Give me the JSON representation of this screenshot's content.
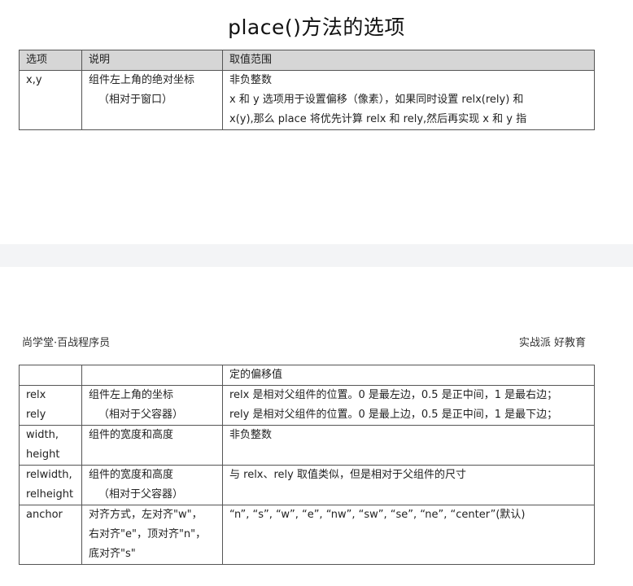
{
  "page1": {
    "title": "place()方法的选项",
    "table": {
      "headers": [
        "选项",
        "说明",
        "取值范围"
      ],
      "rows": [
        {
          "option": [
            "x,y"
          ],
          "desc": [
            "组件左上角的绝对坐标",
            "（相对于窗口）"
          ],
          "range": [
            "非负整数",
            "x 和 y 选项用于设置偏移（像素），如果同时设置 relx(rely) 和",
            "x(y),那么 place 将优先计算 relx 和 rely,然后再实现 x 和 y 指"
          ]
        }
      ]
    }
  },
  "page2": {
    "header_left": "尚学堂·百战程序员",
    "header_right": "实战派 好教育",
    "table": {
      "rows": [
        {
          "option": [
            ""
          ],
          "desc": [
            ""
          ],
          "range": [
            "定的偏移值"
          ]
        },
        {
          "option": [
            "relx",
            "rely"
          ],
          "desc": [
            "组件左上角的坐标",
            "（相对于父容器）"
          ],
          "range": [
            "relx 是相对父组件的位置。0 是最左边，0.5 是正中间，1 是最右边；",
            "rely 是相对父组件的位置。0 是最上边，0.5 是正中间，1 是最下边；"
          ]
        },
        {
          "option": [
            "width,",
            "height"
          ],
          "desc": [
            "组件的宽度和高度"
          ],
          "range": [
            "非负整数"
          ]
        },
        {
          "option": [
            "relwidth,",
            "relheight"
          ],
          "desc": [
            "组件的宽度和高度",
            "（相对于父容器）"
          ],
          "range": [
            "与 relx、rely 取值类似，但是相对于父组件的尺寸"
          ]
        },
        {
          "option": [
            "anchor"
          ],
          "desc": [
            "对齐方式，左对齐\"w\"，",
            "右对齐\"e\"，顶对齐\"n\"，",
            "底对齐\"s\""
          ],
          "range": [
            "“n”, “s”, “w”, “e”, “nw”, “sw”, “se”, “ne”, “center”(默认)"
          ]
        }
      ]
    }
  }
}
